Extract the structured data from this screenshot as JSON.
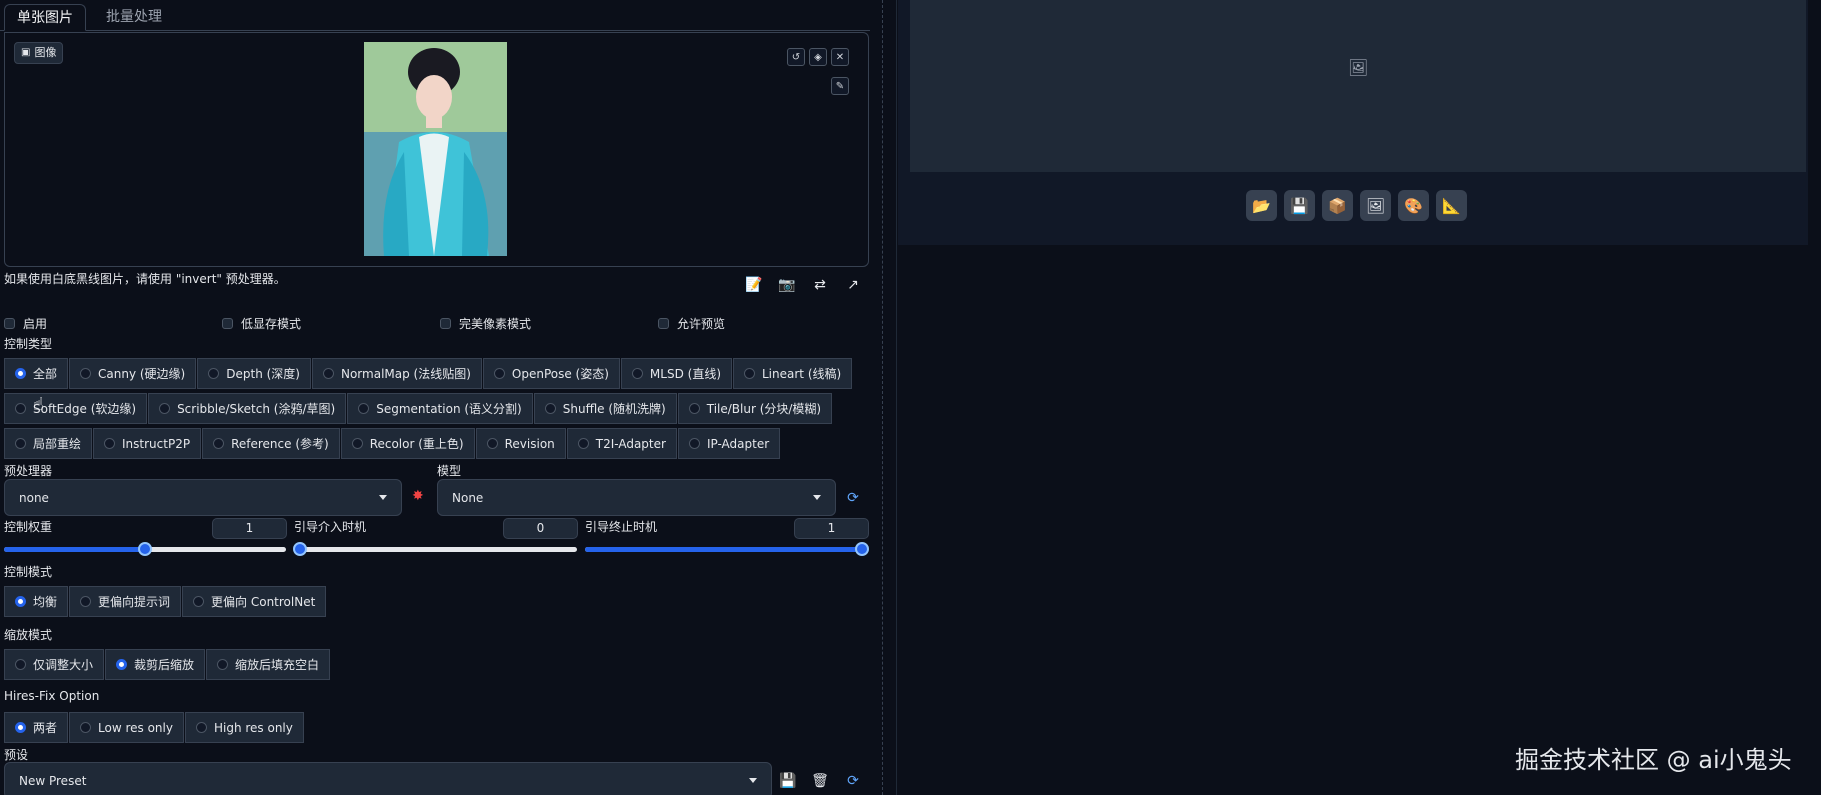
{
  "tabs": [
    "单张图片",
    "批量处理"
  ],
  "image_label": "图像",
  "hint": "如果使用白底黑线图片，请使用 \"invert\" 预处理器。",
  "checkboxes": [
    "启用",
    "低显存模式",
    "完美像素模式",
    "允许预览"
  ],
  "control_type": {
    "label": "控制类型",
    "row1": [
      "全部",
      "Canny (硬边缘)",
      "Depth (深度)",
      "NormalMap (法线贴图)",
      "OpenPose (姿态)",
      "MLSD (直线)",
      "Lineart (线稿)"
    ],
    "row2": [
      "SoftEdge (软边缘)",
      "Scribble/Sketch (涂鸦/草图)",
      "Segmentation (语义分割)",
      "Shuffle (随机洗牌)",
      "Tile/Blur (分块/模糊)"
    ],
    "row3": [
      "局部重绘",
      "InstructP2P",
      "Reference (参考)",
      "Recolor (重上色)",
      "Revision",
      "T2I-Adapter",
      "IP-Adapter"
    ],
    "selected": "全部"
  },
  "preprocessor": {
    "label": "预处理器",
    "value": "none"
  },
  "model": {
    "label": "模型",
    "value": "None"
  },
  "sliders": {
    "weight": {
      "label": "控制权重",
      "value": "1",
      "fraction": 0.5
    },
    "start": {
      "label": "引导介入时机",
      "value": "0",
      "fraction": 0.0
    },
    "end": {
      "label": "引导终止时机",
      "value": "1",
      "fraction": 1.0
    }
  },
  "control_mode": {
    "label": "控制模式",
    "options": [
      "均衡",
      "更偏向提示词",
      "更偏向 ControlNet"
    ],
    "selected": "均衡"
  },
  "resize_mode": {
    "label": "缩放模式",
    "options": [
      "仅调整大小",
      "裁剪后缩放",
      "缩放后填充空白"
    ],
    "selected": "裁剪后缩放"
  },
  "hires": {
    "label": "Hires-Fix Option",
    "options": [
      "两者",
      "Low res only",
      "High res only"
    ],
    "selected": "两者"
  },
  "preset": {
    "label": "预设",
    "value": "New Preset"
  },
  "watermark": "掘金技术社区 @ ai小鬼头",
  "colors": {
    "accent": "#2563eb",
    "bg": "#0b0f19",
    "panel": "#1f2937"
  }
}
